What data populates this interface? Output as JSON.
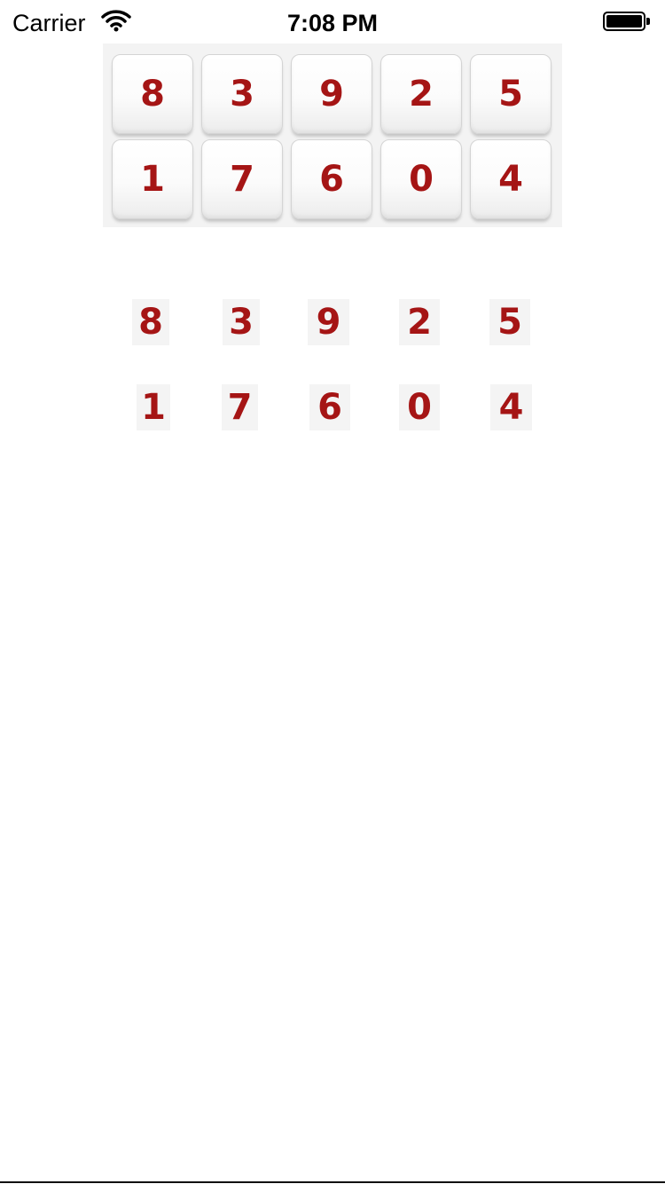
{
  "status_bar": {
    "carrier": "Carrier",
    "time": "7:08 PM",
    "icons": [
      "wifi-icon",
      "battery-icon"
    ]
  },
  "keypad": {
    "rows": [
      [
        "8",
        "3",
        "9",
        "2",
        "5"
      ],
      [
        "1",
        "7",
        "6",
        "0",
        "4"
      ]
    ]
  },
  "digits": {
    "rows": [
      [
        "8",
        "3",
        "9",
        "2",
        "5"
      ],
      [
        "1",
        "7",
        "6",
        "0",
        "4"
      ]
    ]
  },
  "colors": {
    "digit": "#a51515",
    "key_background": "#ffffff",
    "panel_background": "#f3f3f3"
  }
}
